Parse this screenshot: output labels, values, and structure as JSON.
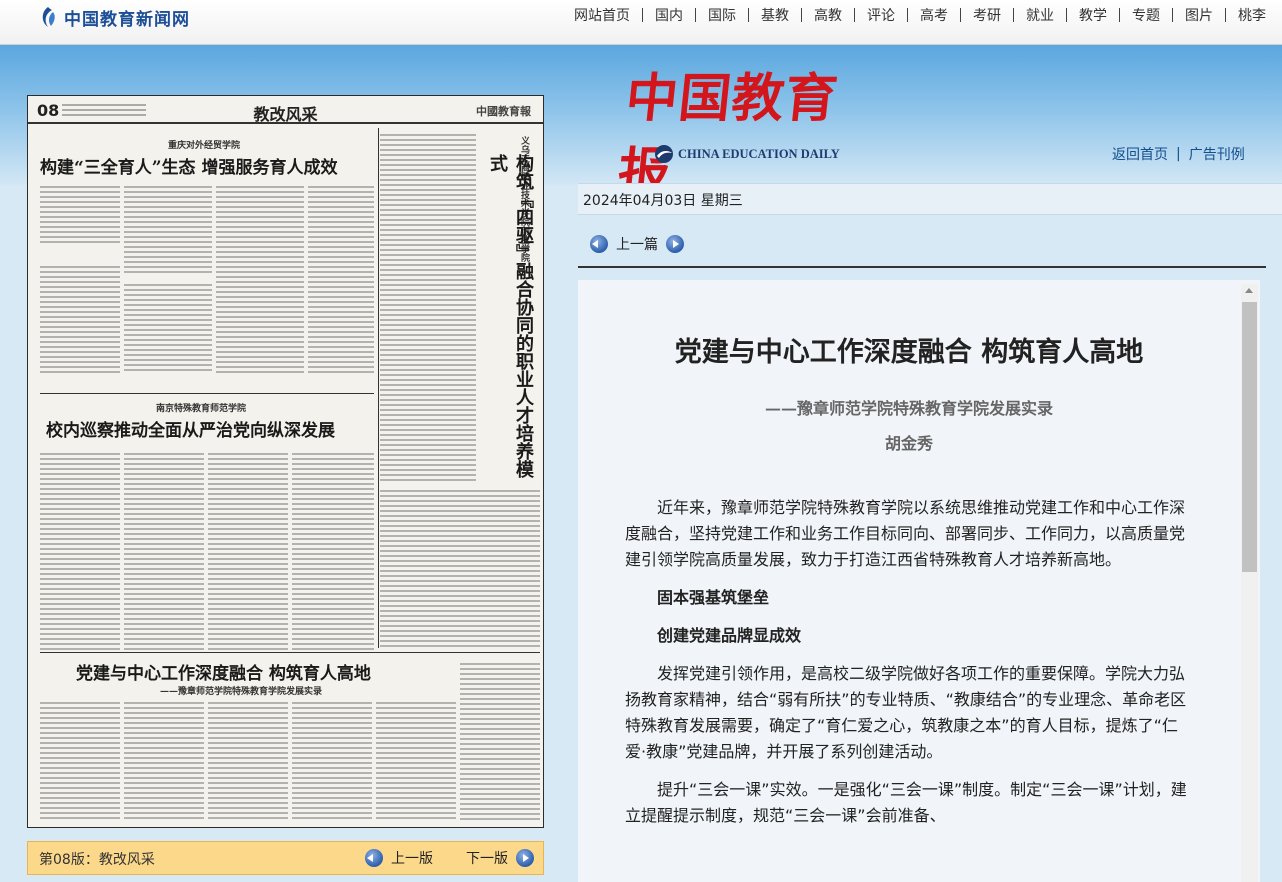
{
  "site": {
    "logo_text": "中国教育新闻网",
    "nav": [
      "网站首页",
      "国内",
      "国际",
      "基教",
      "高教",
      "评论",
      "高考",
      "考研",
      "就业",
      "教学",
      "专题",
      "图片",
      "桃李"
    ]
  },
  "masthead": {
    "cn": "中国教育报",
    "en": "CHINA EDUCATION DAILY",
    "links": [
      "返回首页",
      "广告刊例"
    ]
  },
  "paper": {
    "page_no": "08",
    "section": "教改风采",
    "logo": "中國教育報",
    "stories": [
      {
        "kicker": "重庆对外经贸学院",
        "title": "构建“三全育人”生态 增强服务育人成效"
      },
      {
        "kicker": "义乌工商职业技术学院创业学院",
        "title": "构筑『四驱』融合协同的职业人才培养模式"
      },
      {
        "kicker": "南京特殊教育师范学院",
        "title": "校内巡察推动全面从严治党向纵深发展"
      },
      {
        "kicker": "——豫章师范学院特殊教育学院发展实录",
        "title": "党建与中心工作深度融合 构筑育人高地"
      }
    ],
    "bar_label": "第08版：教改风采",
    "prev_label": "上一版",
    "next_label": "下一版"
  },
  "date": "2024年04月03日  星期三",
  "prev_article": "上一篇",
  "article": {
    "title": "党建与中心工作深度融合 构筑育人高地",
    "subtitle": "——豫章师范学院特殊教育学院发展实录",
    "author": "胡金秀",
    "p1": "近年来，豫章师范学院特殊教育学院以系统思维推动党建工作和中心工作深度融合，坚持党建工作和业务工作目标同向、部署同步、工作同力，以高质量党建引领学院高质量发展，致力于打造江西省特殊教育人才培养新高地。",
    "h1": "固本强基筑堡垒",
    "h2": "创建党建品牌显成效",
    "p2": "发挥党建引领作用，是高校二级学院做好各项工作的重要保障。学院大力弘扬教育家精神，结合“弱有所扶”的专业特质、“教康结合”的专业理念、革命老区特殊教育发展需要，确定了“育仁爱之心，筑教康之本”的育人目标，提炼了“仁爱·教康”党建品牌，并开展了系列创建活动。",
    "p3": "提升“三会一课”实效。一是强化“三会一课”制度。制定“三会一课”计划，建立提醒提示制度，规范“三会一课”会前准备、"
  }
}
